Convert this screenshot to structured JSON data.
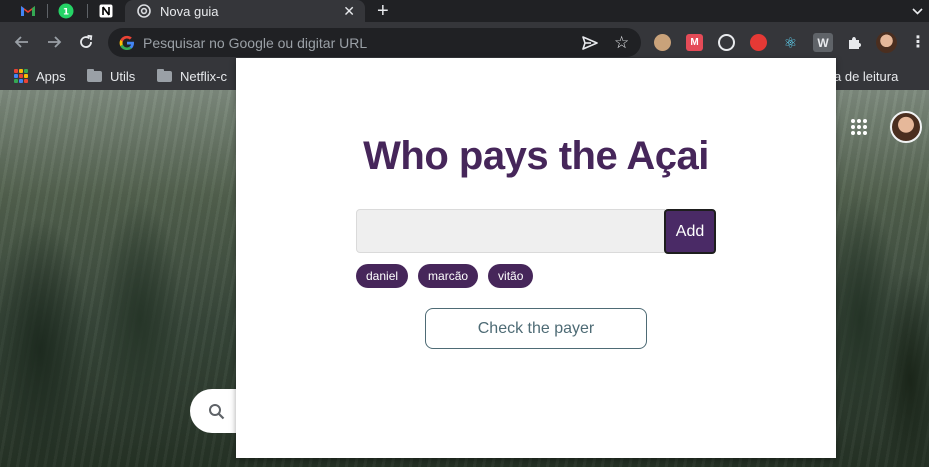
{
  "browser": {
    "tabs": [
      {
        "label": "Nova guia",
        "active": true
      }
    ],
    "pinned_tabs": [
      "gmail-icon",
      "whatsapp-icon",
      "notion-icon"
    ],
    "new_tab_symbol": "+",
    "close_symbol": "✕",
    "address_bar": {
      "placeholder": "Pesquisar no Google ou digitar URL"
    },
    "extensions": [
      "extension-icon-1",
      "M",
      "extension-icon-3",
      "extension-icon-4",
      "⚛",
      "W",
      "puzzle-icon"
    ],
    "bookmarks": [
      {
        "label": "Apps",
        "icon": "apps-grid-icon"
      },
      {
        "label": "Utils",
        "icon": "folder-icon"
      },
      {
        "label": "Netflix-c",
        "icon": "folder-icon"
      },
      {
        "label": "ista de leitura",
        "icon": "reading-list-icon"
      }
    ]
  },
  "popup": {
    "title": "Who pays the Açai",
    "input": {
      "value": "",
      "placeholder": ""
    },
    "add_label": "Add",
    "names": [
      "daniel",
      "marcão",
      "vitão"
    ],
    "check_label": "Check the payer"
  },
  "colors": {
    "accent": "#46265a",
    "button_outline": "#4e6b75",
    "browser_frame": "#35363a",
    "tab_strip": "#202124"
  }
}
